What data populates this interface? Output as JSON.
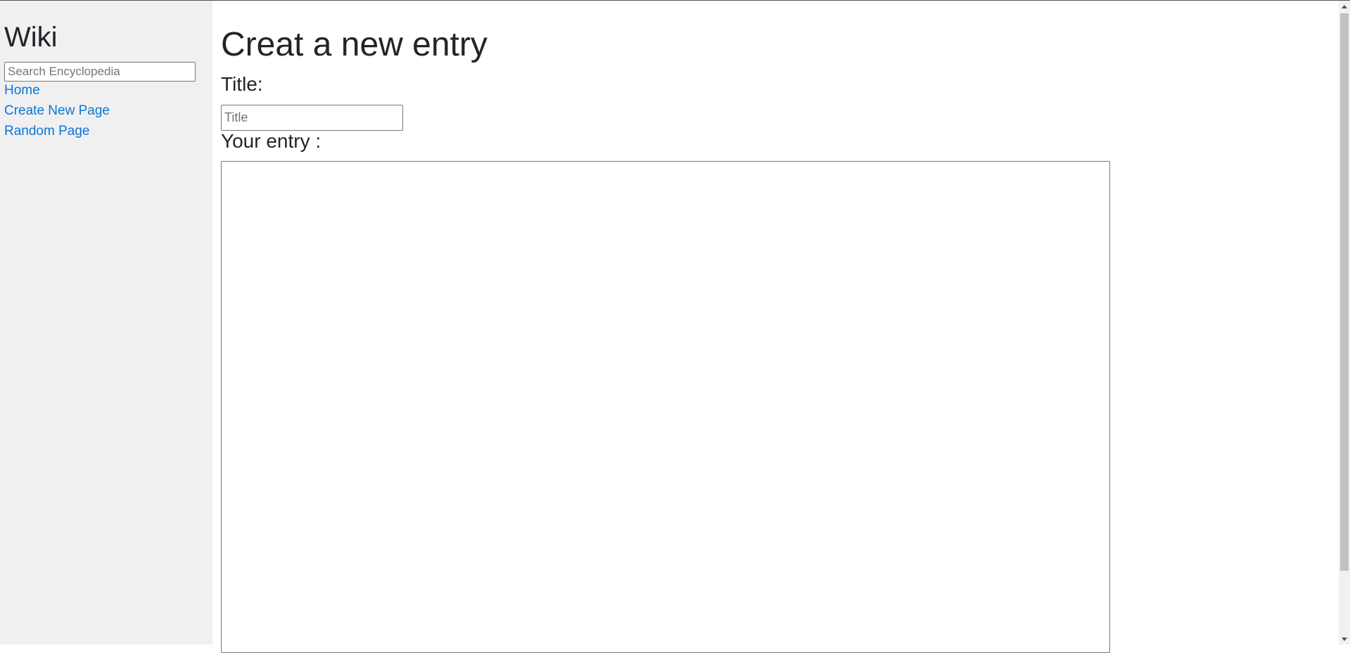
{
  "sidebar": {
    "title": "Wiki",
    "search_placeholder": "Search Encyclopedia",
    "links": {
      "home": "Home",
      "create": "Create New Page",
      "random": "Random Page"
    }
  },
  "main": {
    "heading": "Creat a new entry",
    "title_label": "Title:",
    "title_placeholder": "Title",
    "entry_label": "Your entry :",
    "entry_value": ""
  },
  "colors": {
    "sidebar_bg": "#f0f0f0",
    "link": "#0a75d8",
    "text": "#212529"
  }
}
